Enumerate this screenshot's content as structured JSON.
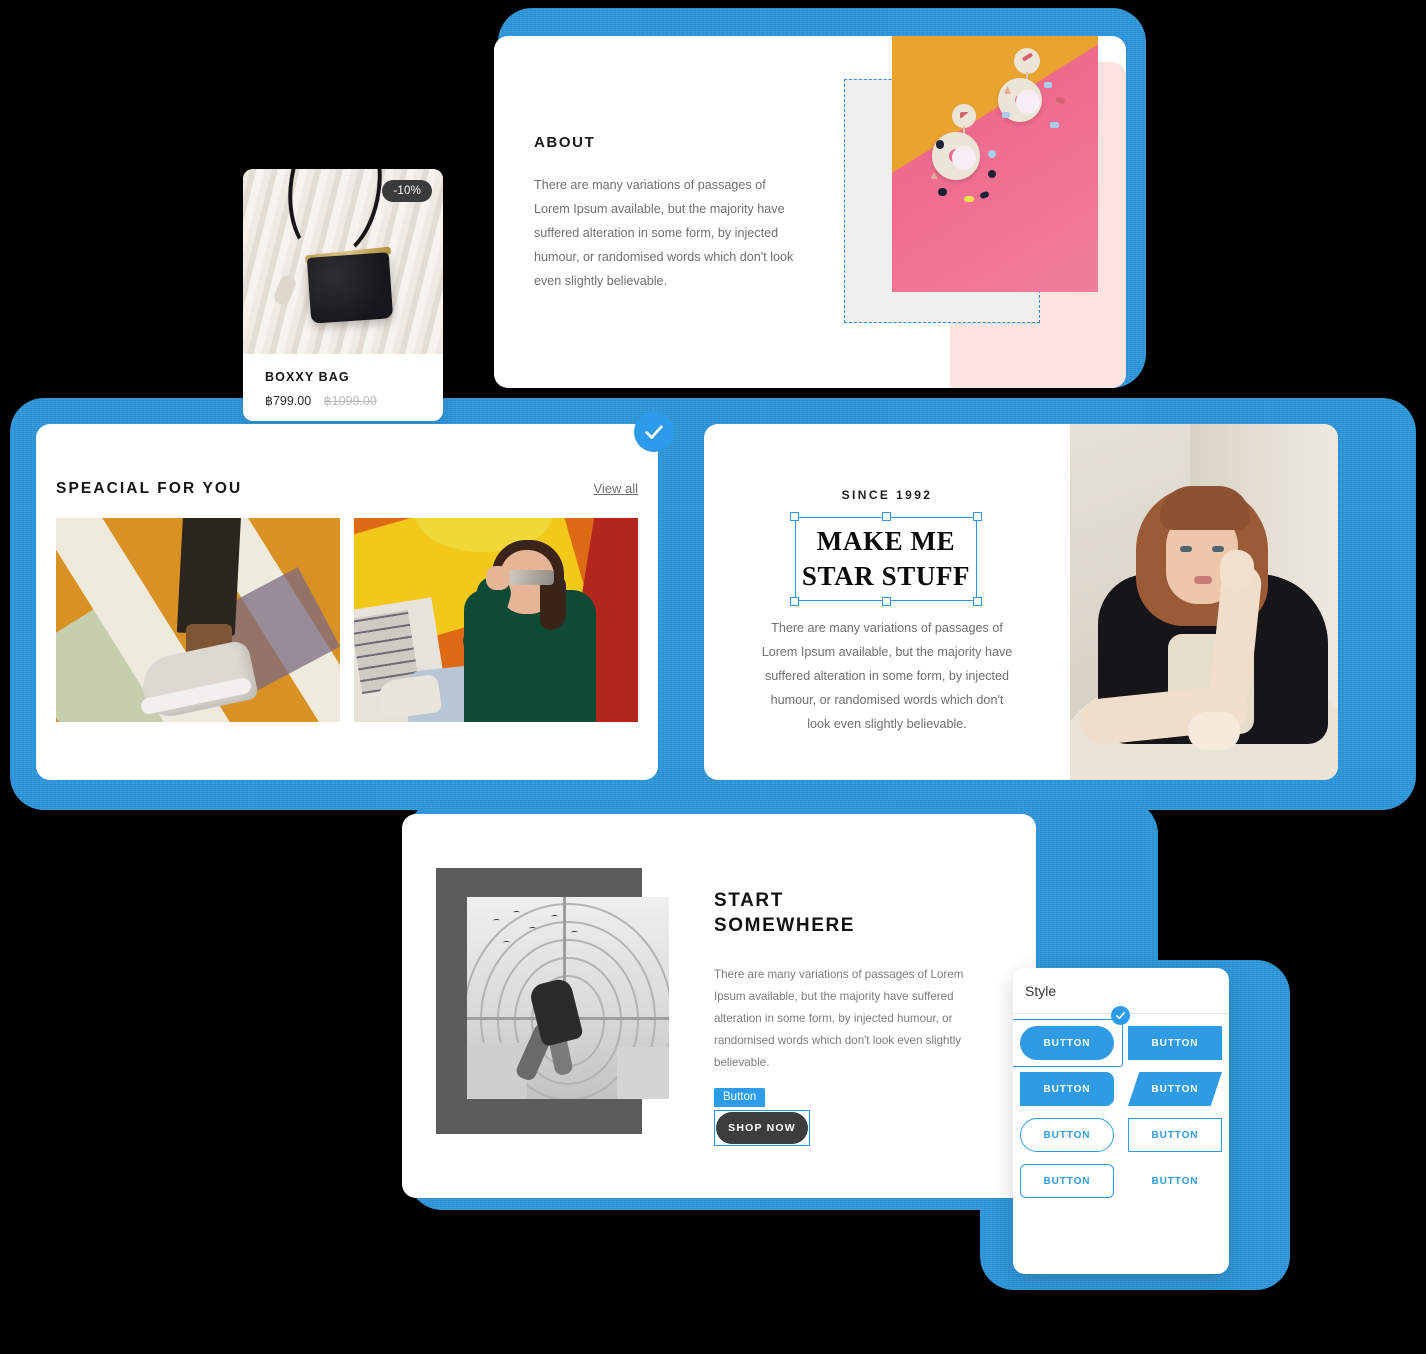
{
  "about": {
    "title": "ABOUT",
    "text": "There are many variations of passages of Lorem Ipsum available, but the majority have suffered alteration in some form, by injected humour, or randomised words which don't look even slightly believable."
  },
  "product": {
    "badge": "-10%",
    "name": "BOXXY BAG",
    "price": "฿799.00",
    "price_old": "฿1099.00"
  },
  "special": {
    "title": "SPEACIAL FOR YOU",
    "view_all": "View all"
  },
  "star": {
    "eyebrow": "SINCE 1992",
    "title_line1": "MAKE ME",
    "title_line2": "STAR STUFF",
    "text": "There are many variations of passages of Lorem Ipsum available, but the majority have suffered alteration in some form, by injected humour, or randomised words which don't look even slightly believable."
  },
  "start": {
    "title_line1": "START",
    "title_line2": "SOMEWHERE",
    "text": "There are many variations of passages of Lorem Ipsum available, but the majority have suffered alteration in some form, by injected humour, or randomised words which don't look even slightly believable.",
    "tag": "Button",
    "cta": "SHOP NOW"
  },
  "style_panel": {
    "title": "Style",
    "buttons": [
      {
        "label": "BUTTON",
        "variant": "filled-pill",
        "selected": true
      },
      {
        "label": "BUTTON",
        "variant": "filled-rect",
        "selected": false
      },
      {
        "label": "BUTTON",
        "variant": "filled-slant",
        "selected": false
      },
      {
        "label": "BUTTON",
        "variant": "filled-para",
        "selected": false
      },
      {
        "label": "BUTTON",
        "variant": "outline-pill",
        "selected": false
      },
      {
        "label": "BUTTON",
        "variant": "outline-rect",
        "selected": false
      },
      {
        "label": "BUTTON",
        "variant": "outline-soft",
        "selected": false
      },
      {
        "label": "BUTTON",
        "variant": "text-only",
        "selected": false
      }
    ]
  },
  "colors": {
    "accent_blue": "#2f9be4",
    "frame_blue": "#3494d4",
    "dark_button": "#3d3d3d",
    "badge_dark": "#3b3b3b"
  }
}
